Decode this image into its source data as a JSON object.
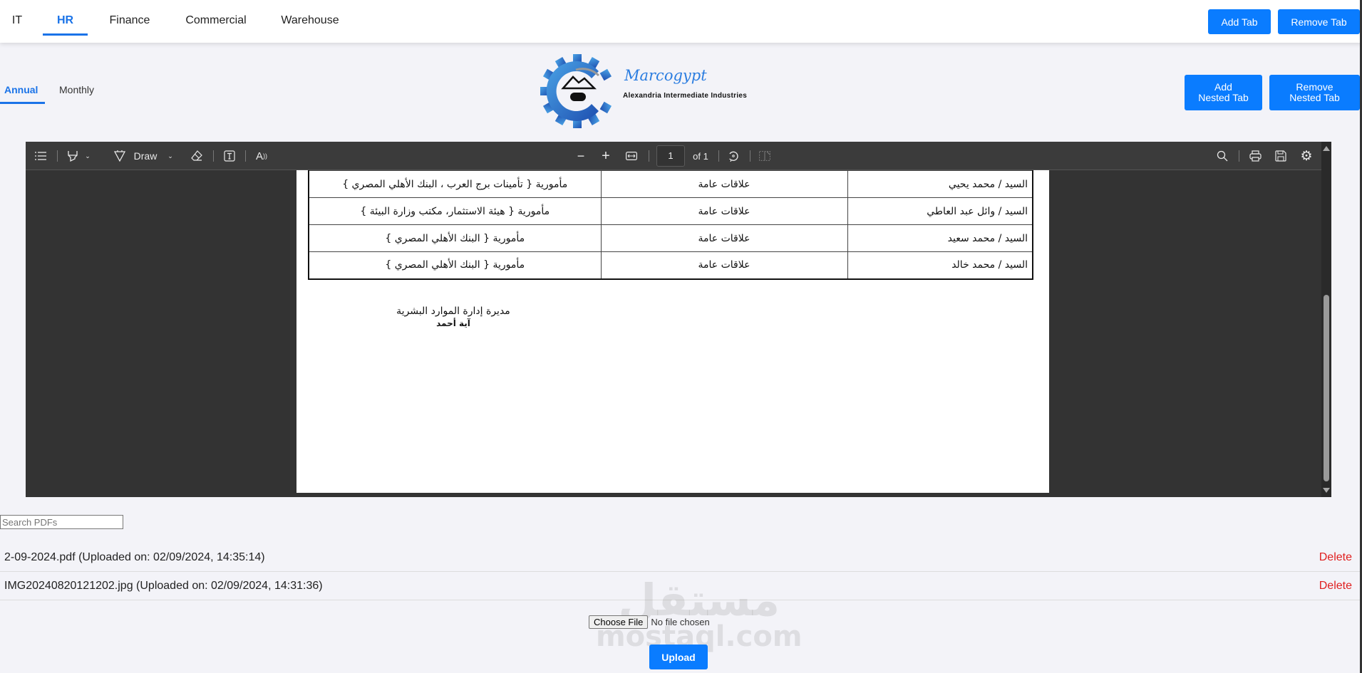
{
  "top_tabs": [
    {
      "label": "IT",
      "active": false
    },
    {
      "label": "HR",
      "active": true
    },
    {
      "label": "Finance",
      "active": false
    },
    {
      "label": "Commercial",
      "active": false
    },
    {
      "label": "Warehouse",
      "active": false
    }
  ],
  "top_actions": {
    "add_tab": "Add Tab",
    "remove_tab": "Remove Tab"
  },
  "nested_tabs": [
    {
      "label": "Annual",
      "active": true
    },
    {
      "label": "Monthly",
      "active": false
    }
  ],
  "nested_actions": {
    "add_line1": "Add",
    "add_line2": "Nested Tab",
    "remove_line1": "Remove",
    "remove_line2": "Nested Tab"
  },
  "logo": {
    "brand": "Marcogypt",
    "subtitle": "Alexandria Intermediate Industries",
    "primary_color": "#2b7de0"
  },
  "viewer": {
    "toolbar": {
      "contents_icon": "list-icon",
      "highlight_icon": "highlighter-icon",
      "draw_label": "Draw",
      "erase_icon": "eraser-icon",
      "textbox_icon": "text-box-icon",
      "read_aloud_icon": "read-aloud-icon",
      "zoom_out": "−",
      "zoom_in": "+",
      "fit_icon": "fit-width-icon",
      "page_current": "1",
      "page_total_label": "of 1",
      "rotate_icon": "rotate-icon",
      "two_page_icon": "page-view-icon",
      "search_icon": "search-icon",
      "print_icon": "print-icon",
      "save_icon": "save-icon",
      "settings_icon": "gear-icon"
    },
    "document": {
      "rows": [
        {
          "name": "السيد / محمد يحيي",
          "dept": "علاقات عامة",
          "task": "مأمورية { تأمينات برج العرب ، البنك الأهلي المصري }"
        },
        {
          "name": "السيد / وائل عبد العاطي",
          "dept": "علاقات عامة",
          "task": "مأمورية { هيئة الاستثمار، مكتب وزارة البيئة }"
        },
        {
          "name": "السيد / محمد سعيد",
          "dept": "علاقات عامة",
          "task": "مأمورية { البنك الأهلي المصري }"
        },
        {
          "name": "السيد / محمد خالد",
          "dept": "علاقات عامة",
          "task": "مأمورية { البنك الأهلي المصري }"
        }
      ],
      "signature_title": "مديرة إدارة الموارد البشرية",
      "signature_name": "آية أحمد"
    }
  },
  "search": {
    "placeholder": "Search PDFs",
    "value": ""
  },
  "files": [
    {
      "label": "2-09-2024.pdf (Uploaded on: 02/09/2024, 14:35:14)",
      "delete": "Delete"
    },
    {
      "label": "IMG20240820121202.jpg (Uploaded on: 02/09/2024, 14:31:36)",
      "delete": "Delete"
    }
  ],
  "upload": {
    "choose_label": "Choose File",
    "no_file": "No file chosen",
    "upload_label": "Upload"
  },
  "watermark": {
    "arabic": "مستقل",
    "latin": "mostaql.com"
  }
}
